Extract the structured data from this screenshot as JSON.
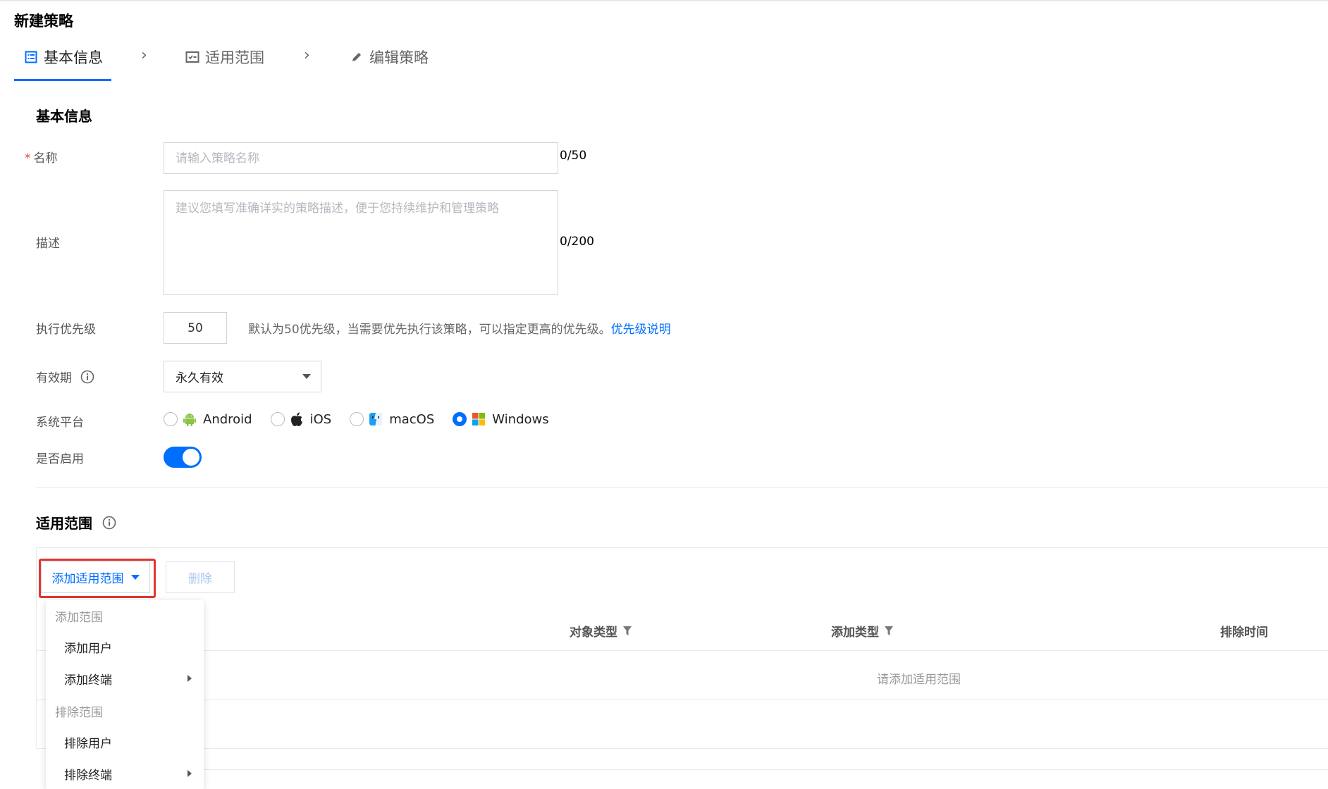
{
  "page": {
    "title": "新建策略"
  },
  "steps": [
    {
      "label": "基本信息",
      "icon": "list-icon",
      "active": true
    },
    {
      "label": "适用范围",
      "icon": "calendar-check-icon",
      "active": false
    },
    {
      "label": "编辑策略",
      "icon": "pencil-icon",
      "active": false
    }
  ],
  "basic": {
    "section_title": "基本信息",
    "name": {
      "label": "名称",
      "required_mark": "*",
      "placeholder": "请输入策略名称",
      "value": "",
      "counter": "0/50"
    },
    "description": {
      "label": "描述",
      "placeholder": "建议您填写准确详实的策略描述，便于您持续维护和管理策略",
      "value": "",
      "counter": "0/200"
    },
    "priority": {
      "label": "执行优先级",
      "value": "50",
      "hint": "默认为50优先级，当需要优先执行该策略，可以指定更高的优先级。",
      "link": "优先级说明"
    },
    "validity": {
      "label": "有效期",
      "selected": "永久有效",
      "info_icon": "info-icon"
    },
    "platform": {
      "label": "系统平台",
      "options": [
        {
          "label": "Android",
          "icon": "android-icon",
          "checked": false
        },
        {
          "label": "iOS",
          "icon": "apple-icon",
          "checked": false
        },
        {
          "label": "macOS",
          "icon": "finder-icon",
          "checked": false
        },
        {
          "label": "Windows",
          "icon": "windows-icon",
          "checked": true
        }
      ]
    },
    "enabled": {
      "label": "是否启用",
      "on": true
    }
  },
  "scope": {
    "section_title": "适用范围",
    "add_button": "添加适用范围",
    "delete_button": "删除",
    "columns": [
      "对象类型",
      "添加类型",
      "排除时间"
    ],
    "empty_text": "请添加适用范围",
    "dropdown": {
      "groups": [
        {
          "title": "添加范围",
          "items": [
            {
              "label": "添加用户",
              "has_submenu": false
            },
            {
              "label": "添加终端",
              "has_submenu": true
            }
          ]
        },
        {
          "title": "排除范围",
          "items": [
            {
              "label": "排除用户",
              "has_submenu": false
            },
            {
              "label": "排除终端",
              "has_submenu": true
            }
          ]
        }
      ]
    }
  },
  "colors": {
    "accent": "#006eff",
    "highlight": "#e5342f",
    "required": "#e54545"
  }
}
